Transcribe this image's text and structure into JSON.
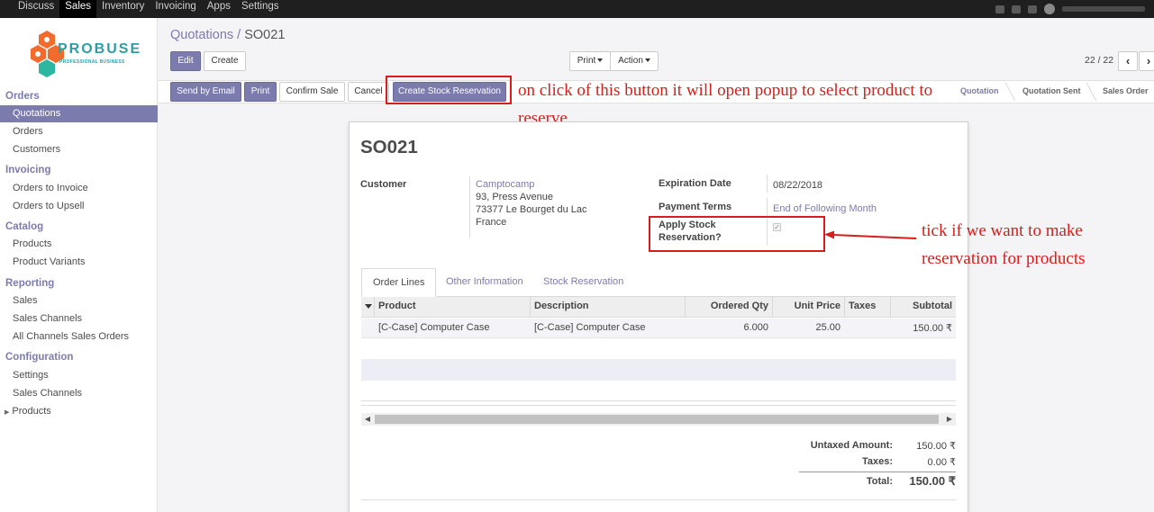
{
  "topnav": {
    "menu": [
      "Discuss",
      "Sales",
      "Inventory",
      "Invoicing",
      "Apps",
      "Settings"
    ],
    "active": "Sales"
  },
  "logo": {
    "text": "PROBUSE",
    "sub": "PROFESSIONAL BUSINESS"
  },
  "sidebar": {
    "sections": [
      {
        "title": "Orders",
        "items": [
          "Quotations",
          "Orders",
          "Customers"
        ]
      },
      {
        "title": "Invoicing",
        "items": [
          "Orders to Invoice",
          "Orders to Upsell"
        ]
      },
      {
        "title": "Catalog",
        "items": [
          "Products",
          "Product Variants"
        ]
      },
      {
        "title": "Reporting",
        "items": [
          "Sales",
          "Sales Channels",
          "All Channels Sales Orders"
        ]
      },
      {
        "title": "Configuration",
        "items": [
          "Settings",
          "Sales Channels",
          "Products"
        ]
      }
    ],
    "active_item": "Quotations"
  },
  "breadcrumb": {
    "parent": "Quotations",
    "separator": "/",
    "current": "SO021"
  },
  "toolbar": {
    "edit": "Edit",
    "create": "Create",
    "print": "Print",
    "action": "Action"
  },
  "pager": {
    "value": "22 / 22"
  },
  "header_buttons": {
    "send_email": "Send by Email",
    "print": "Print",
    "confirm": "Confirm Sale",
    "cancel": "Cancel",
    "stock_reservation": "Create Stock Reservation"
  },
  "statusbar": {
    "stages": [
      "Quotation",
      "Quotation Sent",
      "Sales Order"
    ],
    "current": "Quotation"
  },
  "annotations": {
    "button_note": "on click of this button it will open popup to select product to reserve",
    "checkbox_note": "tick if we want to make reservation for products"
  },
  "form": {
    "title": "SO021",
    "customer_label": "Customer",
    "customer_name": "Camptocamp",
    "address_line1": "93, Press Avenue",
    "address_line2": "73377 Le Bourget du Lac",
    "address_line3": "France",
    "expiration_label": "Expiration Date",
    "expiration_value": "08/22/2018",
    "payment_terms_label": "Payment Terms",
    "payment_terms_value": "End of Following Month",
    "apply_stock_label_1": "Apply Stock",
    "apply_stock_label_2": "Reservation?",
    "apply_stock_checked": true
  },
  "tabs": [
    "Order Lines",
    "Other Information",
    "Stock Reservation"
  ],
  "order_lines": {
    "columns": [
      "Product",
      "Description",
      "Ordered Qty",
      "Unit Price",
      "Taxes",
      "Subtotal"
    ],
    "rows": [
      {
        "product": "[C-Case] Computer Case",
        "description": "[C-Case] Computer Case",
        "qty": "6.000",
        "unit_price": "25.00",
        "taxes": "",
        "subtotal": "150.00 ₹"
      }
    ]
  },
  "totals": {
    "untaxed_label": "Untaxed Amount:",
    "untaxed_value": "150.00 ₹",
    "taxes_label": "Taxes:",
    "taxes_value": "0.00 ₹",
    "total_label": "Total:",
    "total_value": "150.00 ₹"
  },
  "colors": {
    "brand": "#7c7bad",
    "annotation": "#d81d1d",
    "topbar": "#1f1f1f"
  }
}
